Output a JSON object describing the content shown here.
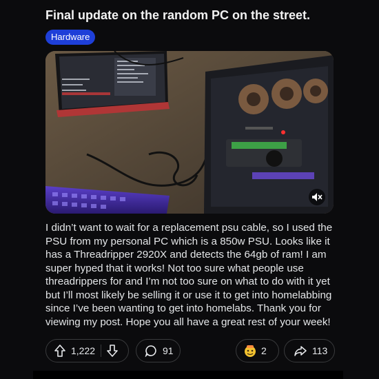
{
  "post": {
    "title": "Final update on the random PC on the street.",
    "flair": "Hardware",
    "body": "I didn’t want to wait for a replacement psu cable, so I used the PSU from my personal PC which is a 850w PSU. Looks like it has a Threadripper 2920X and detects the 64gb of ram! I am super hyped that it works! Not too sure what people use threadrippers for and I’m not too sure on what to do with it yet but I’ll most likely be selling it or use it to get into homelabbing since I’ve been wanting to get into homelabs. Thank you for viewing my post. Hope you all have a great rest of your week!",
    "media_icon": "mute-icon"
  },
  "actions": {
    "upvotes": "1,222",
    "comments": "91",
    "awards": "2",
    "shares": "113"
  },
  "colors": {
    "background": "#0b0b0d",
    "flair": "#1e3fd8",
    "pill_border": "#3a3b3d"
  }
}
